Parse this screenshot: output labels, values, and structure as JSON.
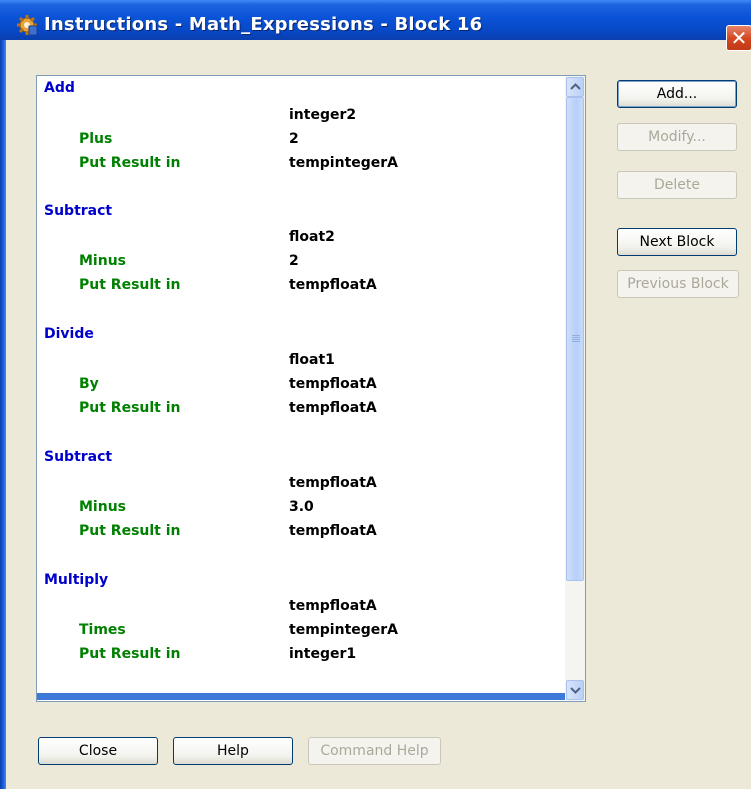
{
  "window": {
    "title": "Instructions - Math_Expressions - Block 16",
    "close_glyph": "✕"
  },
  "instructions": [
    {
      "operation": "Add",
      "operand": "integer2",
      "params": [
        {
          "label": "Plus",
          "value": "2"
        },
        {
          "label": "Put Result in",
          "value": "tempintegerA"
        }
      ]
    },
    {
      "operation": "Subtract",
      "operand": "float2",
      "params": [
        {
          "label": "Minus",
          "value": "2"
        },
        {
          "label": "Put Result in",
          "value": "tempfloatA"
        }
      ]
    },
    {
      "operation": "Divide",
      "operand": "float1",
      "params": [
        {
          "label": "By",
          "value": "tempfloatA"
        },
        {
          "label": "Put Result in",
          "value": "tempfloatA"
        }
      ]
    },
    {
      "operation": "Subtract",
      "operand": "tempfloatA",
      "params": [
        {
          "label": "Minus",
          "value": "3.0"
        },
        {
          "label": "Put Result in",
          "value": "tempfloatA"
        }
      ]
    },
    {
      "operation": "Multiply",
      "operand": "tempfloatA",
      "params": [
        {
          "label": "Times",
          "value": "tempintegerA"
        },
        {
          "label": "Put Result in",
          "value": "integer1"
        }
      ]
    }
  ],
  "side_buttons": {
    "add": "Add...",
    "modify": "Modify...",
    "delete": "Delete",
    "next_block": "Next Block",
    "previous_block": "Previous Block"
  },
  "bottom_buttons": {
    "close": "Close",
    "help": "Help",
    "command_help": "Command Help"
  },
  "colors": {
    "operation": "#0000cc",
    "param_label": "#008000",
    "title_bar": "#0a52d6"
  },
  "icons": {
    "app": "gear-icon",
    "close": "close-icon",
    "scroll_up": "chevron-up-icon",
    "scroll_down": "chevron-down-icon"
  }
}
